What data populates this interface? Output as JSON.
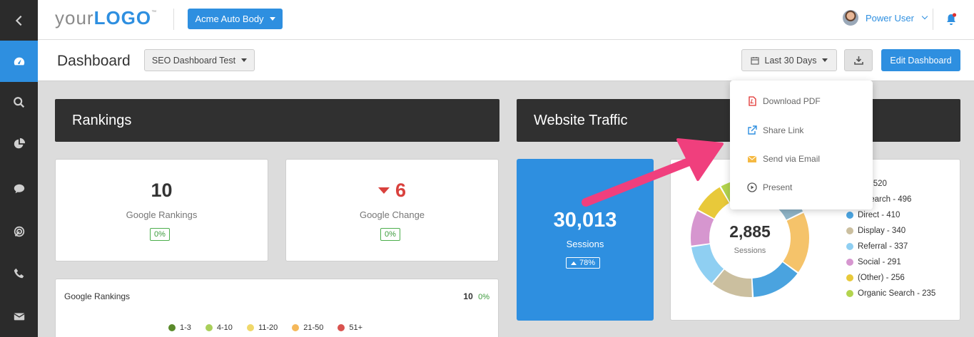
{
  "logo": {
    "prefix": "your",
    "strong": "LOGO",
    "tm": "™"
  },
  "client_selector": {
    "label": "Acme Auto Body"
  },
  "user": {
    "name": "Power User"
  },
  "page": {
    "title": "Dashboard",
    "dashboard_selector": "SEO Dashboard Test",
    "date_range": "Last 30 Days",
    "edit_label": "Edit Dashboard"
  },
  "dropdown": {
    "items": [
      {
        "label": "Download PDF",
        "color": "#e0302e"
      },
      {
        "label": "Share Link",
        "color": "#2e8fe0"
      },
      {
        "label": "Send via Email",
        "color": "#f5b942"
      },
      {
        "label": "Present",
        "color": "#555555"
      }
    ]
  },
  "rankings": {
    "title": "Rankings",
    "google_rankings": {
      "value": "10",
      "label": "Google Rankings",
      "badge": "0%"
    },
    "google_change": {
      "value": "6",
      "label": "Google Change",
      "badge": "0%",
      "color": "#d9413d"
    },
    "chart": {
      "title": "Google Rankings",
      "value": "10",
      "change": "0%",
      "legend": [
        {
          "label": "1-3",
          "color": "#5a8a2a"
        },
        {
          "label": "4-10",
          "color": "#a9cf5a"
        },
        {
          "label": "11-20",
          "color": "#f0d86a"
        },
        {
          "label": "21-50",
          "color": "#f5b85a"
        },
        {
          "label": "51+",
          "color": "#d9534f"
        }
      ]
    }
  },
  "traffic": {
    "title": "Website Traffic",
    "sessions": {
      "value": "30,013",
      "label": "Sessions",
      "badge": "78%"
    },
    "donut": {
      "total": "2,885",
      "label": "Sessions"
    },
    "legend": [
      {
        "label": "ail - 520",
        "color": "#8fb4c7"
      },
      {
        "label": "d Search - 496",
        "color": "#f5c36a"
      },
      {
        "label": "Direct - 410",
        "color": "#4aa3df"
      },
      {
        "label": "Display - 340",
        "color": "#cbbf9f"
      },
      {
        "label": "Referral - 337",
        "color": "#8fcff2"
      },
      {
        "label": "Social - 291",
        "color": "#d696cf"
      },
      {
        "label": "(Other) - 256",
        "color": "#e8c93a"
      },
      {
        "label": "Organic Search - 235",
        "color": "#b3d44e"
      }
    ]
  },
  "colors": {
    "accent": "#2e8fe0",
    "sidebar": "#2b2b2b",
    "annotation_arrow": "#f03f7d"
  }
}
